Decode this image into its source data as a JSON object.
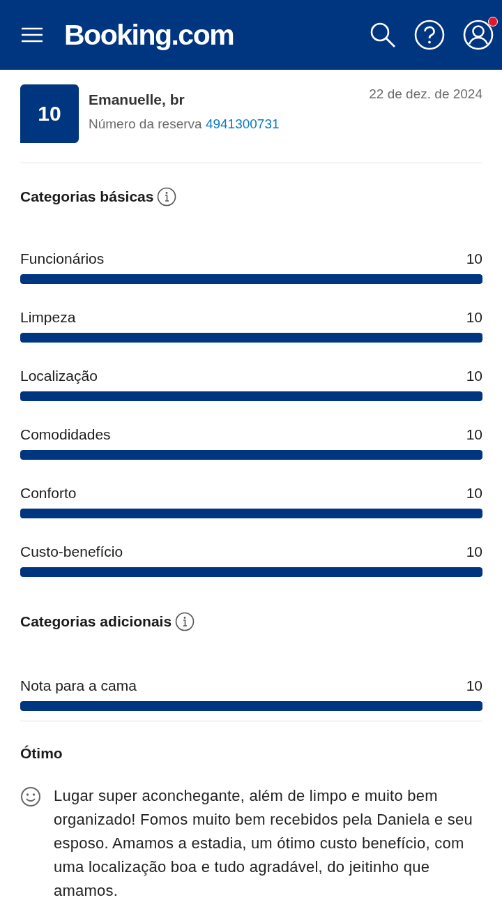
{
  "header": {
    "logo": "Booking.com",
    "has_notification": true
  },
  "review": {
    "score": "10",
    "reviewer": "Emanuelle, br",
    "booking_label": "Número da reserva",
    "booking_number": "4941300731",
    "date": "22 de dez. de 2024"
  },
  "sections": [
    {
      "title": "Categorias básicas",
      "categories": [
        {
          "name": "Funcionários",
          "score": "10",
          "level": 1
        },
        {
          "name": "Limpeza",
          "score": "10",
          "level": 1
        },
        {
          "name": "Localização",
          "score": "10",
          "level": 1
        },
        {
          "name": "Comodidades",
          "score": "10",
          "level": 1
        },
        {
          "name": "Conforto",
          "score": "10",
          "level": 1
        },
        {
          "name": "Custo-benefício",
          "score": "10",
          "level": 1
        }
      ]
    },
    {
      "title": "Categorias adicionais",
      "categories": [
        {
          "name": "Nota para a cama",
          "score": "10",
          "level": 1
        }
      ]
    }
  ],
  "comment": {
    "title": "Ótimo",
    "text": "Lugar super aconchegante, além de limpo e muito bem organizado! Fomos muito bem recebidos pela Daniela e seu esposo. Amamos a estadia, um ótimo custo benefício, com uma localização boa e tudo agradável, do jeitinho que amamos."
  }
}
